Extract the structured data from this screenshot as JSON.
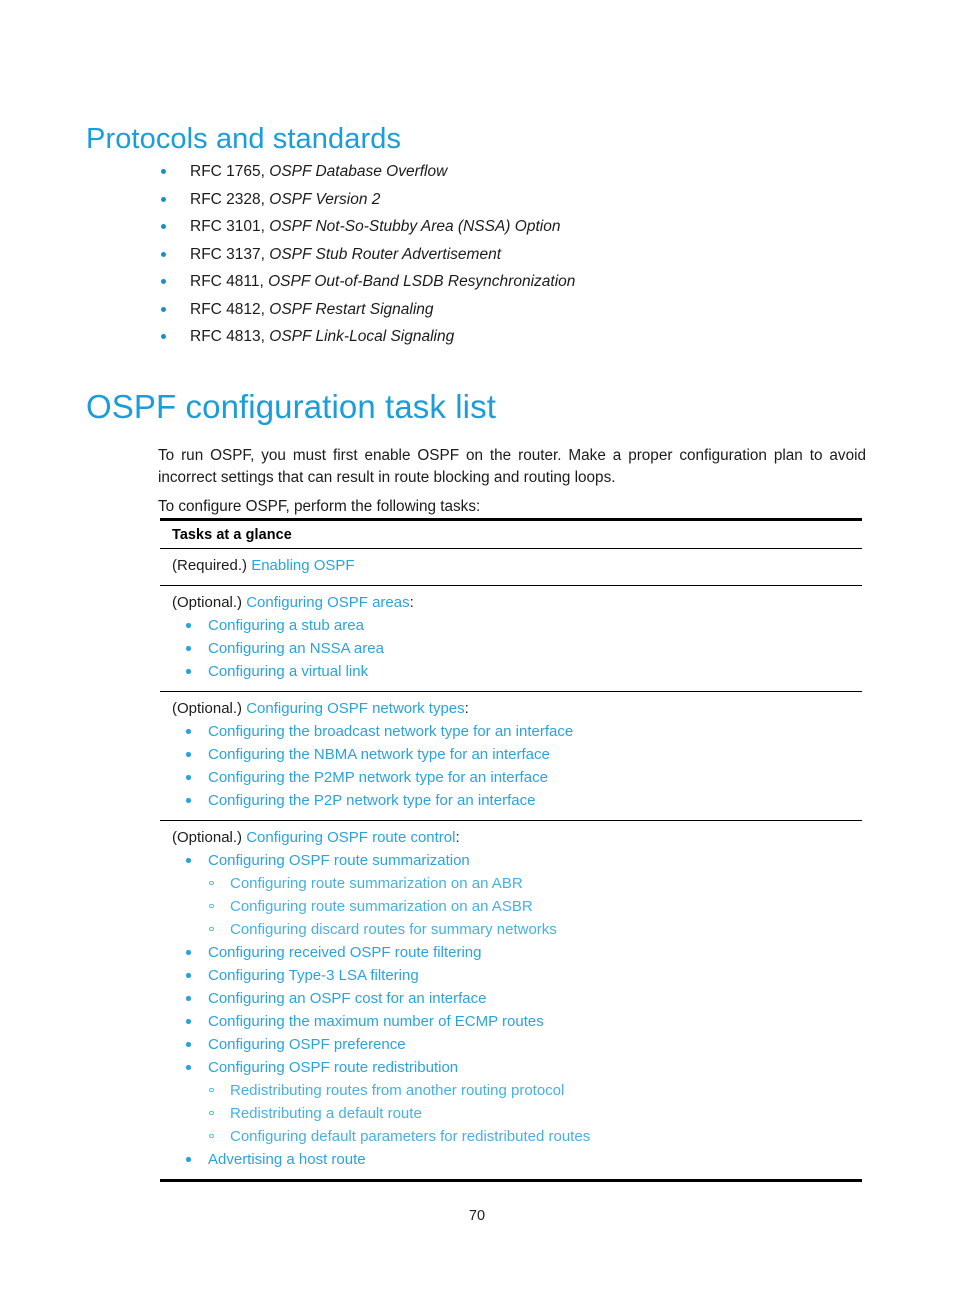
{
  "colors": {
    "heading_blue": "#1a9dd9",
    "link_blue": "#2aa3db",
    "sublink_blue": "#46b0e0",
    "body_text": "#1b1b1b",
    "rule_black": "#000000"
  },
  "sections": {
    "protocols_heading": "Protocols and standards",
    "task_list_heading": "OSPF configuration task list"
  },
  "rfc_list": [
    {
      "code": "RFC 1765, ",
      "title": "OSPF Database Overflow"
    },
    {
      "code": "RFC 2328, ",
      "title": "OSPF Version 2"
    },
    {
      "code": "RFC 3101, ",
      "title": "OSPF Not-So-Stubby Area (NSSA) Option"
    },
    {
      "code": "RFC 3137, ",
      "title": "OSPF Stub Router Advertisement"
    },
    {
      "code": "RFC 4811, ",
      "title": "OSPF Out-of-Band LSDB Resynchronization"
    },
    {
      "code": "RFC 4812, ",
      "title": "OSPF Restart Signaling"
    },
    {
      "code": "RFC 4813, ",
      "title": "OSPF Link-Local Signaling"
    }
  ],
  "paragraphs": {
    "intro": "To run OSPF, you must first enable OSPF on the router. Make a proper configuration plan to avoid incorrect settings that can result in route blocking and routing loops.",
    "lead_in": "To configure OSPF, perform the following tasks:"
  },
  "table": {
    "header": "Tasks at a glance",
    "rows": [
      {
        "prefix": "(Required.) ",
        "link": "Enabling OSPF",
        "suffix": "",
        "items": []
      },
      {
        "prefix": "(Optional.) ",
        "link": "Configuring OSPF areas",
        "suffix": ":",
        "items": [
          {
            "label": "Configuring a stub area",
            "children": []
          },
          {
            "label": "Configuring an NSSA area",
            "children": []
          },
          {
            "label": "Configuring a virtual link",
            "children": []
          }
        ]
      },
      {
        "prefix": "(Optional.) ",
        "link": "Configuring OSPF network types",
        "suffix": ":",
        "items": [
          {
            "label": "Configuring the broadcast network type for an interface",
            "children": []
          },
          {
            "label": "Configuring the NBMA network type for an interface",
            "children": []
          },
          {
            "label": "Configuring the P2MP network type for an interface",
            "children": []
          },
          {
            "label": "Configuring the P2P network type for an interface",
            "children": []
          }
        ]
      },
      {
        "prefix": "(Optional.) ",
        "link": "Configuring OSPF route control",
        "suffix": ":",
        "items": [
          {
            "label": "Configuring OSPF route summarization",
            "children": [
              "Configuring route summarization on an ABR",
              "Configuring route summarization on an ASBR",
              "Configuring discard routes for summary networks"
            ]
          },
          {
            "label": "Configuring received OSPF route filtering",
            "children": []
          },
          {
            "label": "Configuring Type-3 LSA filtering",
            "children": []
          },
          {
            "label": "Configuring an OSPF cost for an interface",
            "children": []
          },
          {
            "label": "Configuring the maximum number of ECMP routes",
            "children": []
          },
          {
            "label": "Configuring OSPF preference",
            "children": []
          },
          {
            "label": "Configuring OSPF route redistribution",
            "children": [
              "Redistributing routes from another routing protocol",
              "Redistributing a default route",
              "Configuring default parameters for redistributed routes"
            ]
          },
          {
            "label": "Advertising a host route",
            "children": []
          }
        ]
      }
    ]
  },
  "footer": {
    "page_number": "70"
  }
}
